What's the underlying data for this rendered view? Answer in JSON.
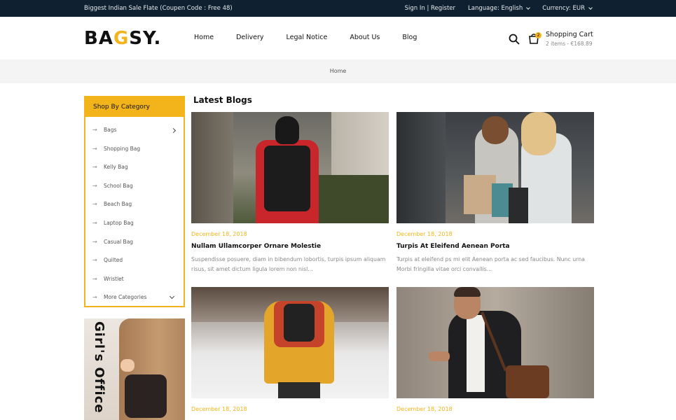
{
  "topbar": {
    "promo": "Biggest Indian Sale Flate (Coupen Code : Free 48)",
    "signin": "Sign In | Register",
    "language": "Language: English",
    "currency": "Currency: EUR"
  },
  "header": {
    "logo_main": "BA",
    "logo_accent": "G",
    "logo_rest": "SY.",
    "nav": [
      "Home",
      "Delivery",
      "Legal Notice",
      "About Us",
      "Blog"
    ],
    "cart_title": "Shopping Cart",
    "cart_sub": "2 items - €168.89",
    "cart_count": "2"
  },
  "breadcrumb": {
    "current": "Home"
  },
  "sidebar": {
    "heading": "Shop By Category",
    "items": [
      {
        "label": "Bags",
        "arrow": "→"
      },
      {
        "label": "Shopping Bag",
        "arrow": "→"
      },
      {
        "label": "Kelly Bag",
        "arrow": "→"
      },
      {
        "label": "School Bag",
        "arrow": "→"
      },
      {
        "label": "Beach Bag",
        "arrow": "→"
      },
      {
        "label": "Laptop Bag",
        "arrow": "→"
      },
      {
        "label": "Casual Bag",
        "arrow": "→"
      },
      {
        "label": "Quilted",
        "arrow": "→"
      },
      {
        "label": "Wristlet",
        "arrow": "→"
      },
      {
        "label": "More Categories",
        "arrow": "→"
      }
    ],
    "banner_text": "Girl's Office"
  },
  "blogs": {
    "heading": "Latest Blogs",
    "posts": [
      {
        "date": "December 18, 2018",
        "title": "Nullam Ullamcorper Ornare Molestie",
        "desc": "Suspendisse posuere, diam in bibendum lobortis, turpis ipsum aliquam risus, sit amet dictum ligula lorem non nisl..."
      },
      {
        "date": "December 18, 2018",
        "title": "Turpis At Eleifend Aenean Porta",
        "desc": "Turpis at eleifend ps mi elit Aenean porta ac sed faucibus. Nunc urna Morbi fringilla vitae orci convallis..."
      },
      {
        "date": "December 18, 2018"
      },
      {
        "date": "December 18, 2018"
      }
    ]
  },
  "colors": {
    "accent": "#f3b41b",
    "topbar": "#0f2130"
  }
}
